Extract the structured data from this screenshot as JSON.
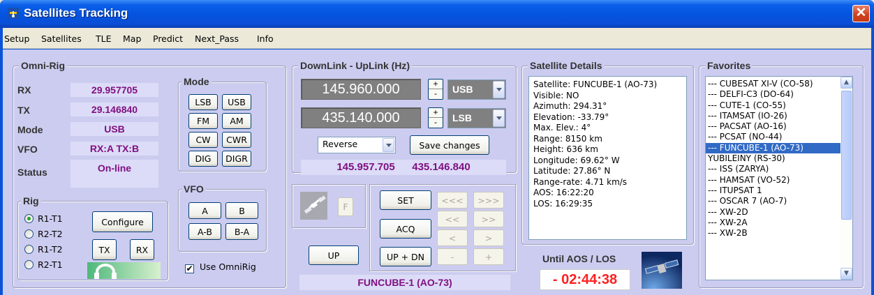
{
  "window": {
    "title": "Satellites Tracking",
    "close_glyph": "✕"
  },
  "menu": [
    "Setup",
    "Satellites",
    "TLE",
    "Map",
    "Predict",
    "Next_Pass",
    "Info"
  ],
  "omni_rig": {
    "title": "Omni-Rig",
    "rx_label": "RX",
    "rx_value": "29.957705",
    "tx_label": "TX",
    "tx_value": "29.146840",
    "mode_label": "Mode",
    "mode_value": "USB",
    "vfo_label": "VFO",
    "vfo_value": "RX:A TX:B",
    "status_label": "Status",
    "status_value": "On-line",
    "mode_group": {
      "title": "Mode",
      "buttons": [
        "LSB",
        "USB",
        "FM",
        "AM",
        "CW",
        "CWR",
        "DIG",
        "DIGR"
      ]
    },
    "vfo_group": {
      "title": "VFO",
      "buttons": [
        "A",
        "B",
        "A-B",
        "B-A"
      ]
    },
    "rig_group": {
      "title": "Rig",
      "options": [
        "R1-T1",
        "R2-T2",
        "R1-T2",
        "R2-T1"
      ],
      "selected": "R1-T1"
    },
    "configure_label": "Configure",
    "tx_button": "TX",
    "rx_button": "RX",
    "use_omnirig_label": "Use OmniRig",
    "use_omnirig_checked": "✔"
  },
  "downlink": {
    "title": "DownLink - UpLink (Hz)",
    "downlink_freq": "145.960.000",
    "downlink_mode": "USB",
    "uplink_freq": "435.140.000",
    "uplink_mode": "LSB",
    "spin_plus": "+",
    "spin_minus": "-",
    "direction": "Reverse",
    "save_label": "Save changes",
    "rx_readout": "145.957.705",
    "tx_readout": "435.146.840",
    "f_button": "F",
    "set_button": "SET",
    "acq_button": "ACQ",
    "up_button": "UP",
    "updn_button": "UP + DN",
    "nav_buttons": [
      "<<<",
      ">>>",
      "<<",
      ">>",
      "<",
      ">",
      "-",
      "+"
    ],
    "current_sat": "FUNCUBE-1 (AO-73)"
  },
  "details": {
    "title": "Satellite Details",
    "lines": [
      "Satellite: FUNCUBE-1 (AO-73)",
      "Visible: NO",
      "Azimuth: 294.31°",
      "Elevation: -33.79°",
      "Max. Elev.: 4°",
      "Range:  8150 km",
      "Height:  636 km",
      "Longitude: 69.62° W",
      "Latitude: 27.86° N",
      "Range-rate: 4.71 km/s",
      "AOS: 16:22:20",
      "LOS: 16:29:35"
    ],
    "until_label": "Until AOS / LOS",
    "countdown": "- 02:44:38"
  },
  "favorites": {
    "title": "Favorites",
    "items": [
      "--- CUBESAT XI-V (CO-58)",
      "--- DELFI-C3 (DO-64)",
      "--- CUTE-1 (CO-55)",
      "--- ITAMSAT (IO-26)",
      "--- PACSAT (AO-16)",
      "--- PCSAT (NO-44)",
      "--- FUNCUBE-1 (AO-73)",
      "YUBILEINY (RS-30)",
      "--- ISS (ZARYA)",
      "--- HAMSAT (VO-52)",
      "--- ITUPSAT 1",
      "--- OSCAR 7 (AO-7)",
      "--- XW-2D",
      "--- XW-2A",
      "--- XW-2B"
    ],
    "selected_index": 6,
    "scroll_up": "▲",
    "scroll_down": "▼"
  },
  "colors": {
    "accent": "#801080",
    "panel": "#ccccf0",
    "selection": "#316ac5",
    "countdown": "#ff2020"
  }
}
